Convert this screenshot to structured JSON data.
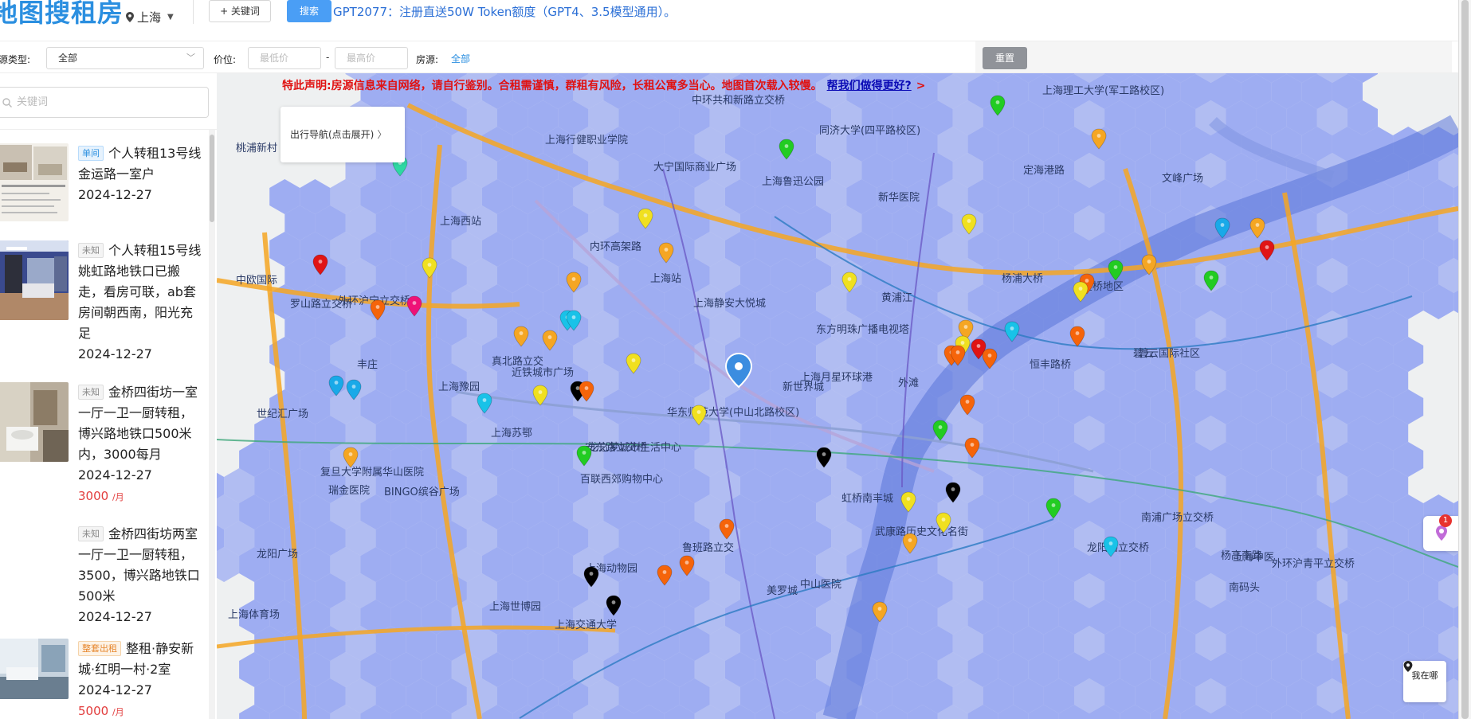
{
  "header": {
    "logo": "地图搜租房",
    "city": "上海",
    "keyword_button": "+ 关键词",
    "search_button": "搜索",
    "promo": "GPT2077：注册直送50W Token额度（GPT4、3.5模型通用）。"
  },
  "filters": {
    "type_label": "源类型:",
    "type_value": "全部",
    "price_label": "价位:",
    "price_min_placeholder": "最低价",
    "price_dash": "-",
    "price_max_placeholder": "最高价",
    "source_label": "房源:",
    "source_value": "全部",
    "reset_button": "重置"
  },
  "sidebar": {
    "search_placeholder": "关键词",
    "listings": [
      {
        "tag": "单间",
        "title": "个人转租13号线金运路一室户",
        "date": "2024-12-27",
        "price": ""
      },
      {
        "tag": "未知",
        "title": "个人转租15号线姚虹路地铁口已搬走，看房可联，ab套房间朝西南，阳光充足",
        "date": "2024-12-27",
        "price": ""
      },
      {
        "tag": "未知",
        "title": "金桥四街坊一室一厅一卫一厨转租，博兴路地铁口500米内，3000每月",
        "date": "2024-12-27",
        "price": "3000",
        "unit": "/月"
      },
      {
        "tag": "未知",
        "title": "金桥四街坊两室一厅一卫一厨转租，3500，博兴路地铁口500米",
        "date": "2024-12-27",
        "price": ""
      },
      {
        "tag": "整套出租",
        "title": "整租·静安新城·红明一村·2室",
        "date": "2024-12-27",
        "price": "5000",
        "unit": "/月"
      }
    ]
  },
  "map": {
    "notice": "特此声明:房源信息来自网络，请自行鉴别。合租需谨慎，群租有风险，长租公寓多当心。地图首次载入较慢。",
    "notice_link": "帮我们做得更好?",
    "notice_arrow": ">",
    "nav_panel": "出行导航(点击展开)",
    "locate_button": "我在哪",
    "float_badge": "1",
    "labels": [
      "中环共和新路立交桥",
      "上海理工大学(军工路校区)",
      "同济大学(四平路校区)",
      "上海行健职业学院",
      "大宁国际商业广场",
      "上海鲁迅公园",
      "新华医院",
      "定海港路",
      "文峰广场",
      "桃浦新村",
      "上海西站",
      "内环高架路",
      "上海站",
      "上海静安大悦城",
      "杨浦大桥",
      "黄浦江",
      "东方明珠广播电视塔",
      "金桥地区",
      "碧云",
      "碧云国际社区",
      "中欧国际",
      "罗山路立交桥",
      "外环沪宁立交桥",
      "丰庄",
      "真北路立交",
      "近铁城市广场",
      "上海月星环球港",
      "恒丰路桥",
      "新世界城",
      "外滩",
      "上海豫园",
      "世纪汇广场",
      "华东师范大学(中山北路校区)",
      "上海苏鄂",
      "安东路立交桥",
      "龙之梦城市生活中心",
      "复旦大学附属华山医院",
      "瑞金医院",
      "BINGO缤谷广场",
      "百联西郊购物中心",
      "虹桥南丰城",
      "武康路历史文化名街",
      "南浦广场立交桥",
      "龙阳路立交桥",
      "龙阳广场",
      "鲁班路立交",
      "上海动物园",
      "美罗城",
      "上海世博园",
      "上海交通大学",
      "上海体育场",
      "外环沪青平立交桥",
      "中山医院",
      "南码头",
      "杨高南路",
      "上海中医"
    ]
  }
}
